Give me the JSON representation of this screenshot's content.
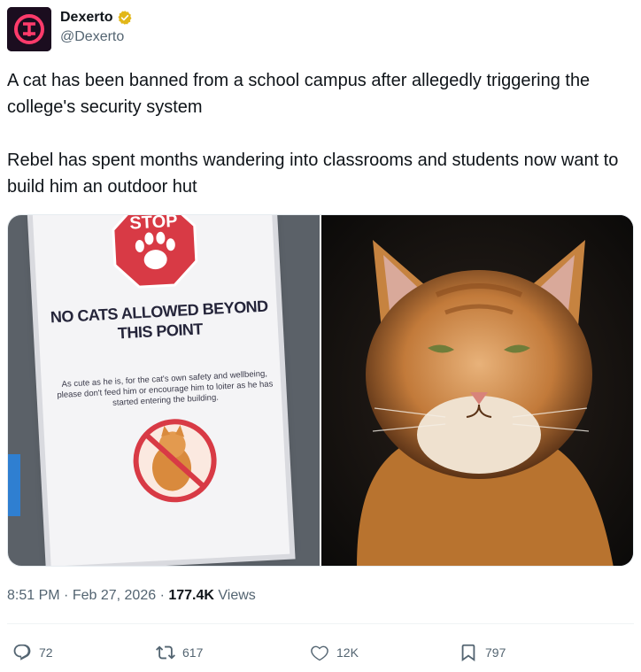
{
  "author": {
    "display_name": "Dexerto",
    "handle": "@Dexerto",
    "verified": true,
    "verified_color": "#e2b719",
    "avatar_icon": "dexerto-logo-icon"
  },
  "post": {
    "paragraphs": [
      "A cat has been banned from a school campus after allegedly triggering the college's security system",
      "Rebel has spent months wandering into classrooms and students now want to build him an outdoor hut"
    ]
  },
  "media": {
    "left_photo": {
      "sign_stop": "STOP",
      "sign_headline_1": "NO CATS ALLOWED BEYOND",
      "sign_headline_2": "THIS POINT",
      "sign_small_text": "As cute as he is, for the cat's own safety and wellbeing, please don't feed him or encourage him to loiter as he has started entering the building."
    },
    "right_photo": {
      "icon": "orange-cat-photo"
    }
  },
  "meta": {
    "time": "8:51 PM",
    "separator": "·",
    "date": "Feb 27, 2026",
    "views_count": "177.4K",
    "views_label": "Views"
  },
  "actions": {
    "replies": "72",
    "reposts": "617",
    "likes": "12K",
    "bookmarks": "797"
  },
  "colors": {
    "text_primary": "#0f1419",
    "text_secondary": "#536471",
    "stop_red": "#d83a45"
  }
}
